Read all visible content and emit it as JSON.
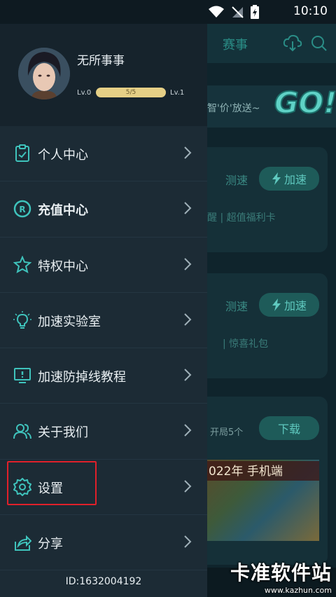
{
  "statusbar": {
    "time": "10:10"
  },
  "profile": {
    "username": "无所事事",
    "level_left": "Lv.0",
    "level_progress": "5/5",
    "level_right": "Lv.1"
  },
  "menu": [
    {
      "label": "个人中心",
      "icon": "clipboard-icon",
      "bold": false
    },
    {
      "label": "充值中心",
      "icon": "coin-icon",
      "bold": true
    },
    {
      "label": "特权中心",
      "icon": "star-badge-icon",
      "bold": false
    },
    {
      "label": "加速实验室",
      "icon": "lightbulb-icon",
      "bold": false
    },
    {
      "label": "加速防掉线教程",
      "icon": "monitor-alert-icon",
      "bold": false
    },
    {
      "label": "关于我们",
      "icon": "people-icon",
      "bold": false
    },
    {
      "label": "设置",
      "icon": "gear-icon",
      "bold": false
    },
    {
      "label": "分享",
      "icon": "share-icon",
      "bold": false
    }
  ],
  "user_id": "ID:1632004192",
  "background": {
    "tab": "赛事",
    "banner_text": "智'价'放送~",
    "banner_go": "GO!",
    "card1": {
      "speed_test": "测速",
      "accelerate": "加速",
      "sub": "醒  |  超值福利卡"
    },
    "card2": {
      "speed_test": "测速",
      "accelerate": "加速",
      "sub": "|  惊喜礼包"
    },
    "card3": {
      "players": "开局5个",
      "download": "下载",
      "image_title": "022年 手机端"
    }
  },
  "watermark": {
    "title": "卡准软件站",
    "url": "www.kazhun.com"
  },
  "colors": {
    "accent": "#5fc9bf",
    "drawer_bg": "#1c2b35",
    "highlight": "#e0202a"
  }
}
